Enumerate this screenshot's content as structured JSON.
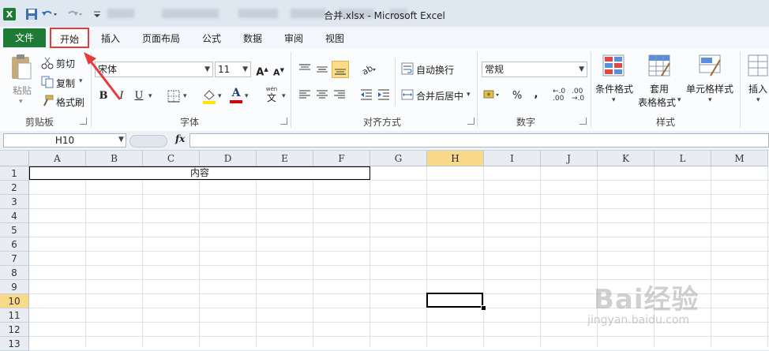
{
  "window": {
    "title": "合并.xlsx - Microsoft Excel"
  },
  "tabs": [
    "文件",
    "开始",
    "插入",
    "页面布局",
    "公式",
    "数据",
    "审阅",
    "视图"
  ],
  "clipboard": {
    "paste": "粘贴",
    "cut": "剪切",
    "copy": "复制",
    "format_painter": "格式刷",
    "group": "剪贴板"
  },
  "font": {
    "name": "宋体",
    "size": "11",
    "group": "字体",
    "bold": "B",
    "italic": "I",
    "underline": "U",
    "grow": "A",
    "shrink": "A",
    "font_color_glyph": "A",
    "phonetic": "wén"
  },
  "alignment": {
    "wrap_text": "自动换行",
    "merge_center": "合并后居中",
    "group": "对齐方式"
  },
  "number": {
    "format": "常规",
    "percent": "%",
    "comma": ",",
    "group": "数字"
  },
  "styles": {
    "conditional": "条件格式",
    "table_line1": "套用",
    "table_line2": "表格格式",
    "cell_styles": "单元格样式",
    "group": "样式"
  },
  "cells": {
    "insert": "插入"
  },
  "formula_bar": {
    "name_box": "H10",
    "fx": "fx",
    "content": ""
  },
  "grid": {
    "columns": [
      "A",
      "B",
      "C",
      "D",
      "E",
      "F",
      "G",
      "H",
      "I",
      "J",
      "K",
      "L",
      "M"
    ],
    "rows": [
      "1",
      "2",
      "3",
      "4",
      "5",
      "6",
      "7",
      "8",
      "9",
      "10",
      "11",
      "12",
      "13"
    ],
    "selected_column": "H",
    "selected_row": "10",
    "merged_content": "内容"
  },
  "watermark": {
    "logo": "Bai经验",
    "url": "jingyan.baidu.com"
  },
  "colors": {
    "file_tab": "#1f7a36",
    "highlight": "#e53b3b",
    "selection_header": "#f9d98a"
  }
}
